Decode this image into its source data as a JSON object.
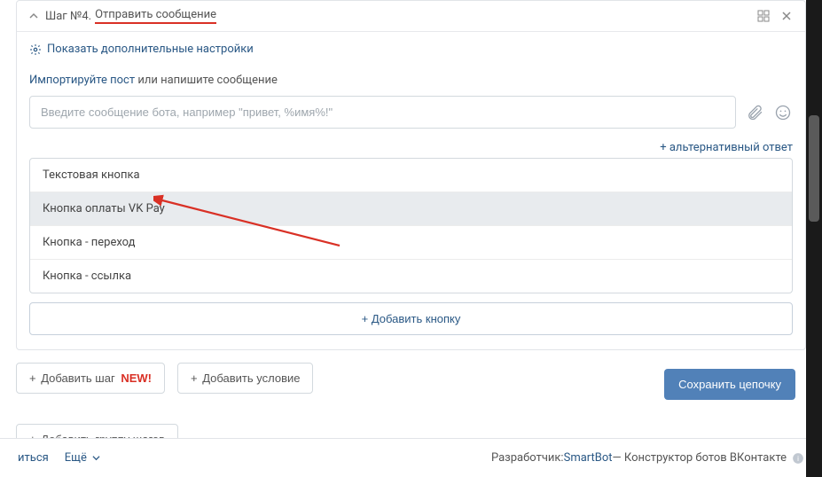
{
  "step": {
    "title_a": "Шаг №4.",
    "title_b": "Отправить сообщение"
  },
  "settings_link": "Показать дополнительные настройки",
  "import": {
    "link": "Импортируйте пост",
    "tail": " или напишите сообщение"
  },
  "message_placeholder": "Введите сообщение бота, например \"привет, %имя%!\"",
  "alt_reply": "+ альтернативный ответ",
  "options": [
    "Текстовая кнопка",
    "Кнопка оплаты VK Pay",
    "Кнопка - переход",
    "Кнопка - ссылка"
  ],
  "add_button": "+ Добавить кнопку",
  "controls": {
    "add_step": "Добавить шаг",
    "new_badge": "NEW!",
    "add_condition": "Добавить условие",
    "add_group": "Добавить группу шагов"
  },
  "save_chain": "Сохранить цепочку",
  "footer": {
    "left1": "иться",
    "left2": "Ещё",
    "dev_label": "Разработчик: ",
    "dev_link": "SmartBot",
    "dev_tail": " — Конструктор ботов ВКонтакте"
  }
}
